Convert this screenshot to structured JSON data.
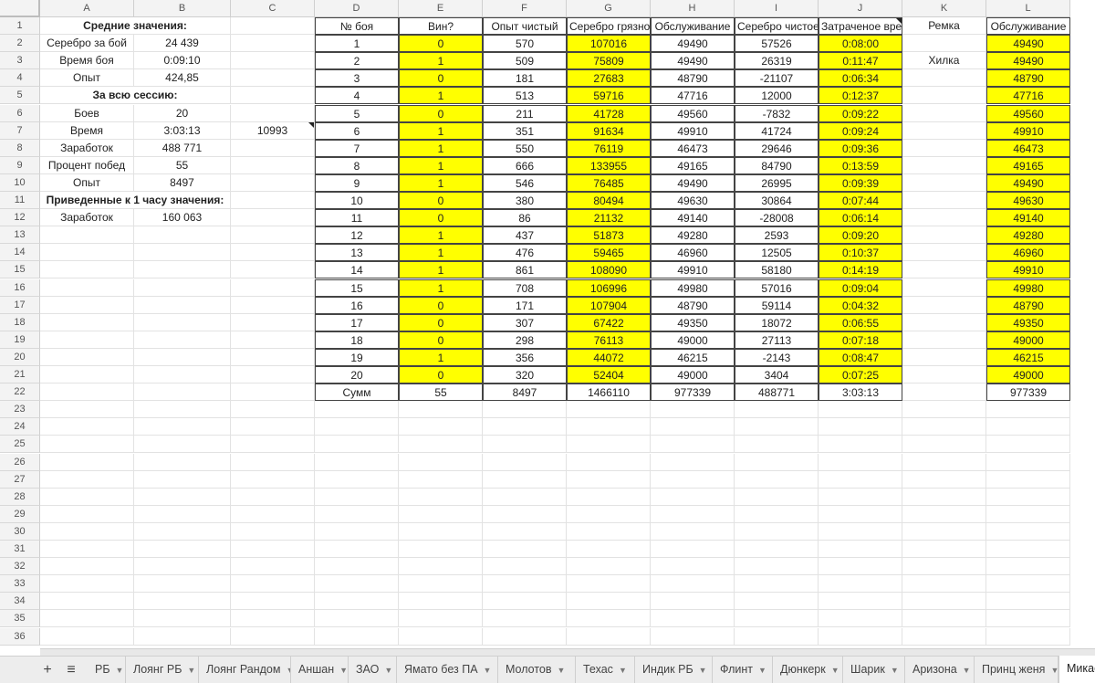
{
  "columns": [
    "A",
    "B",
    "C",
    "D",
    "E",
    "F",
    "G",
    "H",
    "I",
    "J",
    "K",
    "L"
  ],
  "rows": [
    "1",
    "2",
    "3",
    "4",
    "5",
    "6",
    "7",
    "8",
    "9",
    "10",
    "11",
    "12",
    "13",
    "14",
    "15",
    "16",
    "17",
    "18",
    "19",
    "20",
    "21",
    "22",
    "23",
    "24",
    "25",
    "26",
    "27",
    "28",
    "29",
    "30",
    "31",
    "32",
    "33",
    "34",
    "35",
    "36"
  ],
  "summary": {
    "avg_title": "Средние значения:",
    "silver_per_battle_label": "Серебро за бой",
    "silver_per_battle": "24 439",
    "battle_time_label": "Время боя",
    "battle_time": "0:09:10",
    "exp_label": "Опыт",
    "exp": "424,85",
    "session_title": "За всю сессию:",
    "battles_label": "Боев",
    "battles": "20",
    "time_label": "Время",
    "time": "3:03:13",
    "time_extra": "10993",
    "earnings_label": "Заработок",
    "earnings": "488 771",
    "winrate_label": "Процент побед",
    "winrate": "55",
    "exp_total_label": "Опыт",
    "exp_total": "8497",
    "hour_title": "Приведенные к 1 часу значения:",
    "hour_earnings_label": "Заработок",
    "hour_earnings": "160 063"
  },
  "table_headers": [
    "№ боя",
    "Вин?",
    "Опыт чистый",
    "Серебро грязное",
    "Обслуживание",
    "Серебро чистое",
    "Затраченое время"
  ],
  "table_rows": [
    [
      "1",
      "0",
      "570",
      "107016",
      "49490",
      "57526",
      "0:08:00"
    ],
    [
      "2",
      "1",
      "509",
      "75809",
      "49490",
      "26319",
      "0:11:47"
    ],
    [
      "3",
      "0",
      "181",
      "27683",
      "48790",
      "-21107",
      "0:06:34"
    ],
    [
      "4",
      "1",
      "513",
      "59716",
      "47716",
      "12000",
      "0:12:37"
    ],
    [
      "5",
      "0",
      "211",
      "41728",
      "49560",
      "-7832",
      "0:09:22"
    ],
    [
      "6",
      "1",
      "351",
      "91634",
      "49910",
      "41724",
      "0:09:24"
    ],
    [
      "7",
      "1",
      "550",
      "76119",
      "46473",
      "29646",
      "0:09:36"
    ],
    [
      "8",
      "1",
      "666",
      "133955",
      "49165",
      "84790",
      "0:13:59"
    ],
    [
      "9",
      "1",
      "546",
      "76485",
      "49490",
      "26995",
      "0:09:39"
    ],
    [
      "10",
      "0",
      "380",
      "80494",
      "49630",
      "30864",
      "0:07:44"
    ],
    [
      "11",
      "0",
      "86",
      "21132",
      "49140",
      "-28008",
      "0:06:14"
    ],
    [
      "12",
      "1",
      "437",
      "51873",
      "49280",
      "2593",
      "0:09:20"
    ],
    [
      "13",
      "1",
      "476",
      "59465",
      "46960",
      "12505",
      "0:10:37"
    ],
    [
      "14",
      "1",
      "861",
      "108090",
      "49910",
      "58180",
      "0:14:19"
    ],
    [
      "15",
      "1",
      "708",
      "106996",
      "49980",
      "57016",
      "0:09:04"
    ],
    [
      "16",
      "0",
      "171",
      "107904",
      "48790",
      "59114",
      "0:04:32"
    ],
    [
      "17",
      "0",
      "307",
      "67422",
      "49350",
      "18072",
      "0:06:55"
    ],
    [
      "18",
      "0",
      "298",
      "76113",
      "49000",
      "27113",
      "0:07:18"
    ],
    [
      "19",
      "1",
      "356",
      "44072",
      "46215",
      "-2143",
      "0:08:47"
    ],
    [
      "20",
      "0",
      "320",
      "52404",
      "49000",
      "3404",
      "0:07:25"
    ]
  ],
  "totals": [
    "Сумм",
    "55",
    "8497",
    "1466110",
    "977339",
    "488771",
    "3:03:13"
  ],
  "k_column": {
    "remka": "Ремка",
    "hilka": "Хилка"
  },
  "l_column": {
    "header": "Обслуживание",
    "values": [
      "49490",
      "49490",
      "48790",
      "47716",
      "49560",
      "49910",
      "46473",
      "49165",
      "49490",
      "49630",
      "49140",
      "49280",
      "46960",
      "49910",
      "49980",
      "48790",
      "49350",
      "49000",
      "46215",
      "49000"
    ],
    "total": "977339"
  },
  "sheet_tabs": [
    "РБ",
    "Лоянг РБ",
    "Лоянг Рандом",
    "Аншан",
    "ЗАО",
    "Ямато без ПА",
    "Молотов",
    "Техас",
    "Индик РБ",
    "Флинт",
    "Дюнкерк",
    "Шарик",
    "Аризона",
    "Принц женя",
    "Микаса"
  ],
  "active_tab": "Микаса",
  "colors": {
    "highlight": "#ffff00",
    "header_bg": "#f3f3f3"
  }
}
